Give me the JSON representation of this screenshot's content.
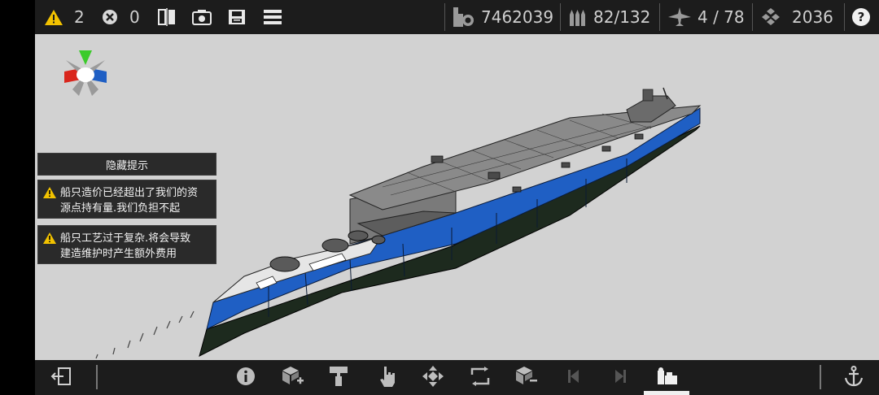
{
  "topbar": {
    "warning_count": "2",
    "error_count": "0",
    "cost": "7462039",
    "armament": "82/132",
    "aircraft": "4 / 78",
    "resources": "2036"
  },
  "hints": {
    "hide_label": "隐藏提示",
    "warnings": [
      {
        "line1": "船只造价已经超出了我们的资",
        "line2": "源点持有量.我们负担不起"
      },
      {
        "line1": "船只工艺过于复杂.将会导致",
        "line2": "建造维护时产生额外费用"
      }
    ]
  },
  "icons": {
    "warning": "warning-icon",
    "error": "error-circle-icon",
    "mirror": "mirror-icon",
    "screenshot": "camera-icon",
    "save": "save-icon",
    "menu": "menu-icon",
    "cost": "cost-icon",
    "ammo": "ammo-icon",
    "plane": "plane-icon",
    "resource": "resource-icon",
    "help": "help-icon",
    "exit": "exit-icon",
    "info": "info-icon",
    "add_block": "add-block-icon",
    "paint": "paint-roller-icon",
    "select": "hand-pointer-icon",
    "move": "move-arrows-icon",
    "rotate": "rotate-icon",
    "remove_block": "remove-block-icon",
    "prev": "prev-icon",
    "next": "next-icon",
    "crew": "crew-icon",
    "anchor": "anchor-icon"
  },
  "colors": {
    "hull_blue": "#1f5fc4",
    "hull_dark": "#1d2a1e",
    "deck_gray": "#8a8a8a",
    "warning_yellow": "#f2c200",
    "bar_bg": "#1c1c1c",
    "viewport_bg": "#d2d2d2"
  }
}
